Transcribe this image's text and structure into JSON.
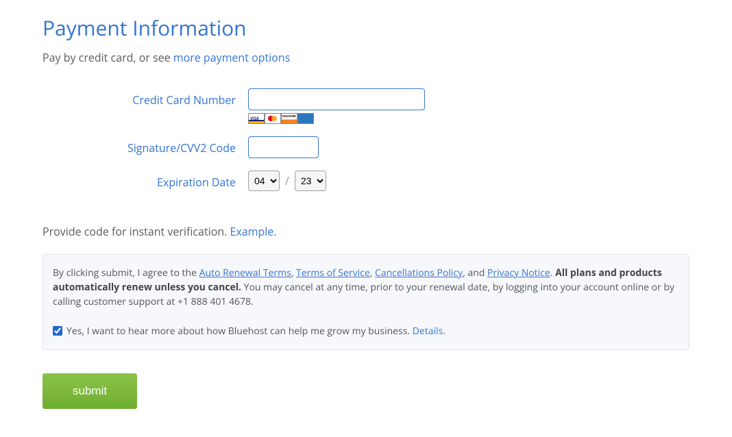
{
  "title": "Payment Information",
  "subtitle_prefix": "Pay by credit card, or see ",
  "subtitle_link": "more payment options",
  "form": {
    "cc_label": "Credit Card Number",
    "cc_value": "",
    "cvv_label": "Signature/CVV2 Code",
    "cvv_value": "",
    "exp_label": "Expiration Date",
    "exp_month": "04",
    "exp_year": "23",
    "slash": "/"
  },
  "verify": {
    "text": "Provide code for instant verification. ",
    "example_link": "Example."
  },
  "terms": {
    "prefix": "By clicking submit, I agree to the ",
    "auto_renewal": "Auto Renewal Terms",
    "sep1": ", ",
    "tos": "Terms of Service",
    "sep2": ", ",
    "cancel": "Cancellations Policy",
    "sep3": ", and ",
    "privacy": "Privacy Notice",
    "period": ". ",
    "bold_text": "All plans and products automatically renew unless you cancel.",
    "rest": " You may cancel at any time, prior to your renewal date, by logging into your account online or by calling customer support at +1 888 401 4678."
  },
  "consent": {
    "checked": true,
    "text": "Yes, I want to hear more about how Bluehost can help me grow my business. ",
    "details": "Details."
  },
  "submit_label": "submit"
}
